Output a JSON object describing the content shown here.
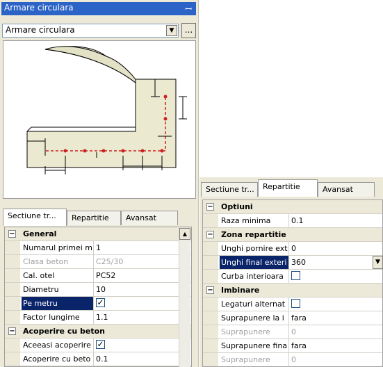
{
  "panel": {
    "title": "Armare circulara",
    "pin_icon": "pin-icon",
    "combo_value": "Armare circulara",
    "more_label": "..."
  },
  "tabs": {
    "left": [
      "Sectiune tr...",
      "Repartitie",
      "Avansat"
    ],
    "right": [
      "Sectiune tr...",
      "Repartitie",
      "Avansat"
    ]
  },
  "left_grid": {
    "general": "General",
    "rows": [
      {
        "name": "Numarul primei m",
        "value": "1"
      },
      {
        "name": "Clasa beton",
        "value": "C25/30"
      },
      {
        "name": "Cal. otel",
        "value": "PC52"
      },
      {
        "name": "Diametru",
        "value": "10"
      },
      {
        "name": "Pe metru",
        "value": ""
      },
      {
        "name": "Factor lungime",
        "value": "1.1"
      }
    ],
    "acoperire": "Acoperire cu beton",
    "rows2": [
      {
        "name": "Aceeasi acoperire",
        "value": ""
      },
      {
        "name": "Acoperire cu beto",
        "value": "0.1"
      }
    ]
  },
  "right_grid": {
    "optiuni": "Optiuni",
    "raza": {
      "name": "Raza minima",
      "value": "0.1"
    },
    "zona": "Zona repartitie",
    "zona_rows": [
      {
        "name": "Unghi pornire ext",
        "value": "0"
      },
      {
        "name": "Unghi final exteri",
        "value": "360"
      },
      {
        "name": "Curba interioara",
        "value": ""
      }
    ],
    "imbinare": "Imbinare",
    "imb_rows": [
      {
        "name": "Legaturi alternat",
        "value": ""
      },
      {
        "name": "Suprapunere la  i",
        "value": "fara"
      },
      {
        "name": "Suprapunere",
        "value": "0"
      },
      {
        "name": "Suprapunere fina",
        "value": "fara"
      },
      {
        "name": "Suprapunere",
        "value": "0"
      }
    ]
  },
  "colors": {
    "titlebar": "#2b63c7",
    "selection": "#0a246a",
    "rebar": "#cc2222",
    "concrete": "#ebe9cf"
  }
}
